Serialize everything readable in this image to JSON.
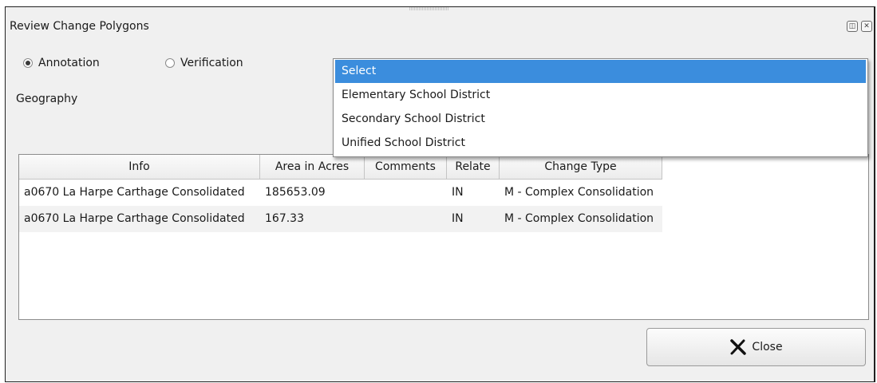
{
  "window": {
    "title": "Review Change Polygons"
  },
  "mode": {
    "options": [
      {
        "label": "Annotation",
        "checked": true
      },
      {
        "label": "Verification",
        "checked": false
      }
    ]
  },
  "geography": {
    "label": "Geography",
    "options": [
      "Select",
      "Elementary School District",
      "Secondary School District",
      "Unified School District"
    ],
    "selected_index": 0
  },
  "table": {
    "columns": [
      "Info",
      "Area in Acres",
      "Comments",
      "Relate",
      "Change Type"
    ],
    "rows": [
      [
        "a0670 La Harpe Carthage Consolidated",
        "185653.09",
        "",
        "IN",
        "M - Complex Consolidation"
      ],
      [
        "a0670 La Harpe Carthage Consolidated",
        "167.33",
        "",
        "IN",
        "M - Complex Consolidation"
      ]
    ]
  },
  "buttons": {
    "close_label": "Close"
  },
  "colors": {
    "selection": "#3b8ddd",
    "window_bg": "#f0f0f0"
  }
}
